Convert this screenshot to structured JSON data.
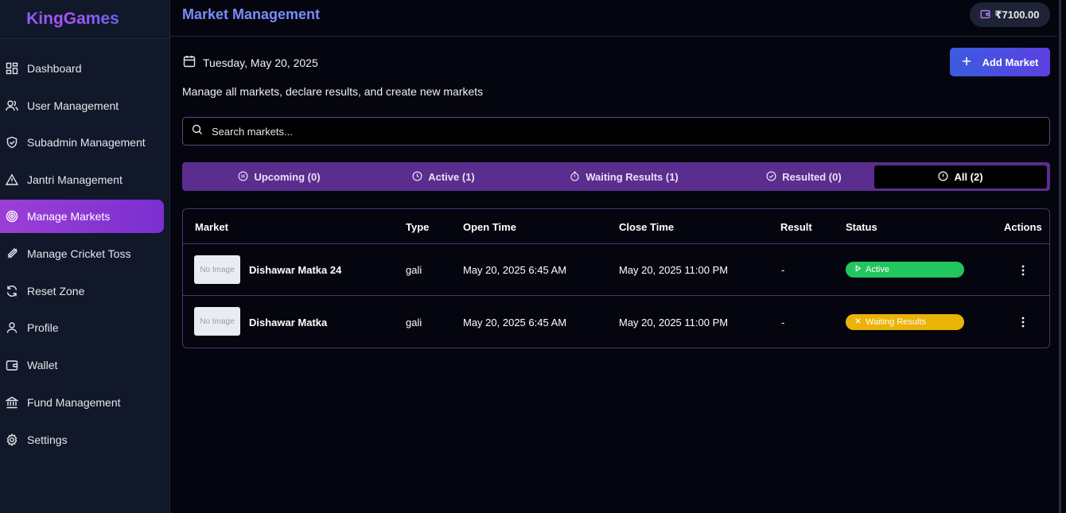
{
  "brand": "KingGames",
  "sidebar": {
    "items": [
      {
        "label": "Dashboard",
        "icon": "dashboard-icon"
      },
      {
        "label": "User Management",
        "icon": "users-icon"
      },
      {
        "label": "Subadmin Management",
        "icon": "shield-icon"
      },
      {
        "label": "Jantri Management",
        "icon": "warning-icon"
      },
      {
        "label": "Manage Markets",
        "icon": "target-icon",
        "active": true
      },
      {
        "label": "Manage Cricket Toss",
        "icon": "cricket-bat-icon"
      },
      {
        "label": "Reset Zone",
        "icon": "refresh-icon"
      },
      {
        "label": "Profile",
        "icon": "user-icon"
      },
      {
        "label": "Wallet",
        "icon": "wallet-icon"
      },
      {
        "label": "Fund Management",
        "icon": "bank-icon"
      },
      {
        "label": "Settings",
        "icon": "gear-icon"
      }
    ]
  },
  "header": {
    "title": "Market Management",
    "balance": "₹7100.00"
  },
  "main": {
    "date": "Tuesday, May 20, 2025",
    "add_button": "Add Market",
    "subtitle": "Manage all markets, declare results, and create new markets",
    "search_placeholder": "Search markets..."
  },
  "tabs": [
    {
      "label": "Upcoming (0)",
      "icon": "pause-icon"
    },
    {
      "label": "Active (1)",
      "icon": "clock-icon"
    },
    {
      "label": "Waiting Results (1)",
      "icon": "timer-icon"
    },
    {
      "label": "Resulted (0)",
      "icon": "check-circle-icon"
    },
    {
      "label": "All (2)",
      "icon": "alert-circle-icon",
      "active": true
    }
  ],
  "table": {
    "columns": [
      "Market",
      "Type",
      "Open Time",
      "Close Time",
      "Result",
      "Status",
      "Actions"
    ],
    "rows": [
      {
        "image": "No Image",
        "market": "Dishawar Matka 24",
        "type": "gali",
        "open": "May 20, 2025 6:45 AM",
        "close": "May 20, 2025 11:00 PM",
        "result": "-",
        "status": "Active"
      },
      {
        "image": "No Image",
        "market": "Dishawar Matka",
        "type": "gali",
        "open": "May 20, 2025 6:45 AM",
        "close": "May 20, 2025 11:00 PM",
        "result": "-",
        "status": "Waiting Results"
      }
    ]
  },
  "colors": {
    "accent": "#7b2fd0",
    "active_status": "#22c55e",
    "waiting_status": "#e9b308",
    "tabs_bg": "#5b2d8e"
  }
}
